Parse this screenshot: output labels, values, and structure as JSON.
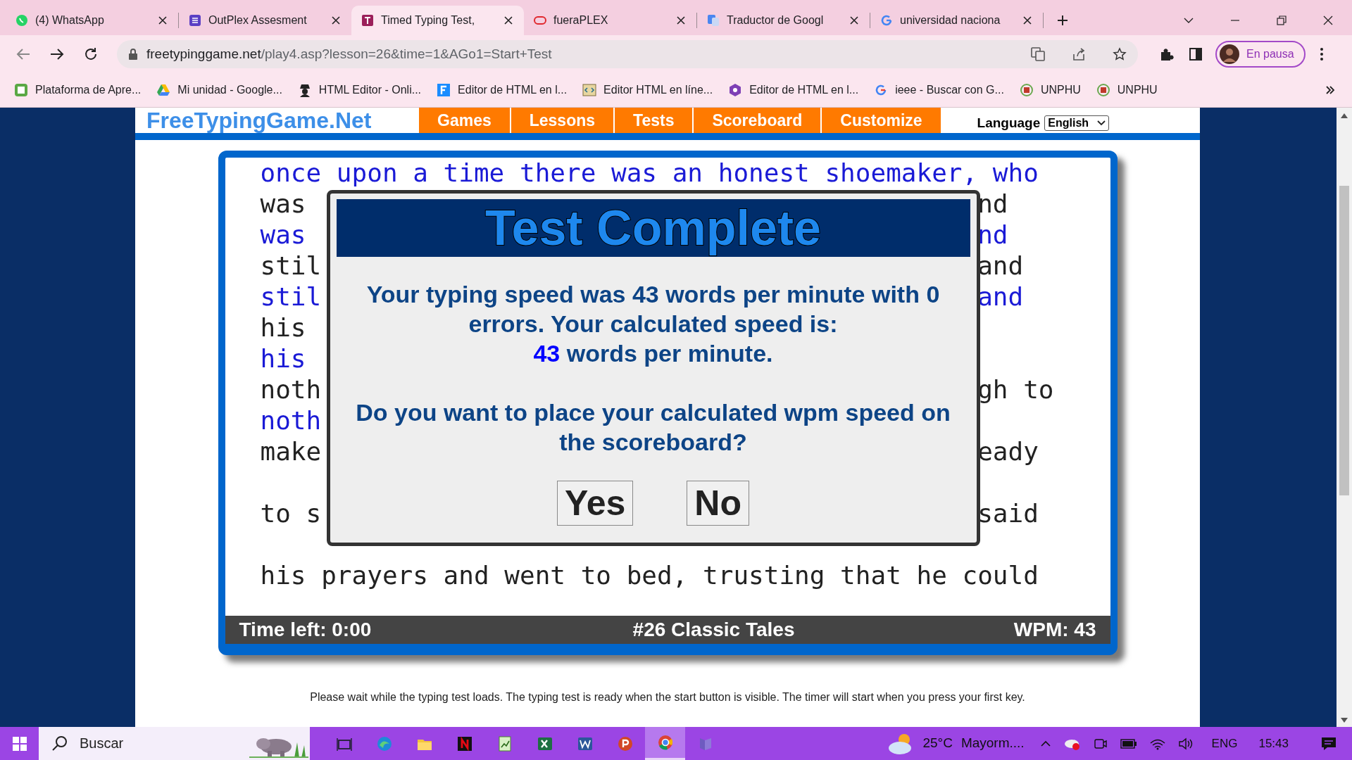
{
  "browser": {
    "tabs": [
      {
        "title": "(4) WhatsApp",
        "selected": false
      },
      {
        "title": "OutPlex Assesment",
        "selected": false
      },
      {
        "title": "Timed Typing Test,",
        "selected": true
      },
      {
        "title": "fueraPLEX",
        "selected": false
      },
      {
        "title": "Traductor de Googl",
        "selected": false
      },
      {
        "title": "universidad naciona",
        "selected": false
      }
    ],
    "address": {
      "domain": "freetypinggame.net",
      "path": "/play4.asp?lesson=26&time=1&AGo1=Start+Test"
    },
    "profile": "En pausa",
    "bookmarks": [
      "Plataforma de Apre...",
      "Mi unidad - Google...",
      "HTML Editor - Onli...",
      "Editor de HTML en l...",
      "Editor HTML en líne...",
      "Editor de HTML en l...",
      "ieee - Buscar con G...",
      "UNPHU",
      "UNPHU"
    ]
  },
  "site": {
    "logo": "FreeTypingGame.Net",
    "nav": [
      "Games",
      "Lessons",
      "Tests",
      "Scoreboard",
      "Customize"
    ],
    "language_label": "Language",
    "language_value": "English"
  },
  "passage": [
    {
      "kind": "typed",
      "left": "once upon a time there was an honest shoemaker, who"
    },
    {
      "kind": "source",
      "left": "was",
      "right": "nd"
    },
    {
      "kind": "typed",
      "left": "was",
      "right": "nd"
    },
    {
      "kind": "source",
      "left": "stil",
      "right": "and"
    },
    {
      "kind": "typed",
      "left": "stil",
      "right": "and"
    },
    {
      "kind": "source",
      "left": "his"
    },
    {
      "kind": "typed",
      "left": "his"
    },
    {
      "kind": "source",
      "left": "noth",
      "right": "gh to"
    },
    {
      "kind": "typed",
      "left": "noth"
    },
    {
      "kind": "source",
      "left": "make",
      "right": "eady"
    },
    {
      "kind": "blank"
    },
    {
      "kind": "source",
      "left": "to s",
      "right": "said"
    },
    {
      "kind": "blank"
    },
    {
      "kind": "source",
      "left": "his prayers and went to bed, trusting that he could"
    }
  ],
  "dialog": {
    "title": "Test Complete",
    "message": "Your typing speed was 43 words per minute with 0 errors. Your calculated speed is:",
    "speed_value": "43",
    "speed_unit": "words per minute.",
    "question": "Do you want to place your calculated wpm speed on the scoreboard?",
    "buttons": [
      "Yes",
      "No"
    ]
  },
  "status_bar": {
    "time_left": "Time left: 0:00",
    "lesson": "#26 Classic Tales",
    "wpm": "WPM: 43"
  },
  "footer_note": "Please wait while the typing test loads. The typing test is ready when the start button is visible. The timer will start when you press your first key.",
  "taskbar": {
    "search_placeholder": "Buscar",
    "temperature": "25°C",
    "weather": "Mayorm....",
    "language": "ENG",
    "time": "15:43"
  }
}
